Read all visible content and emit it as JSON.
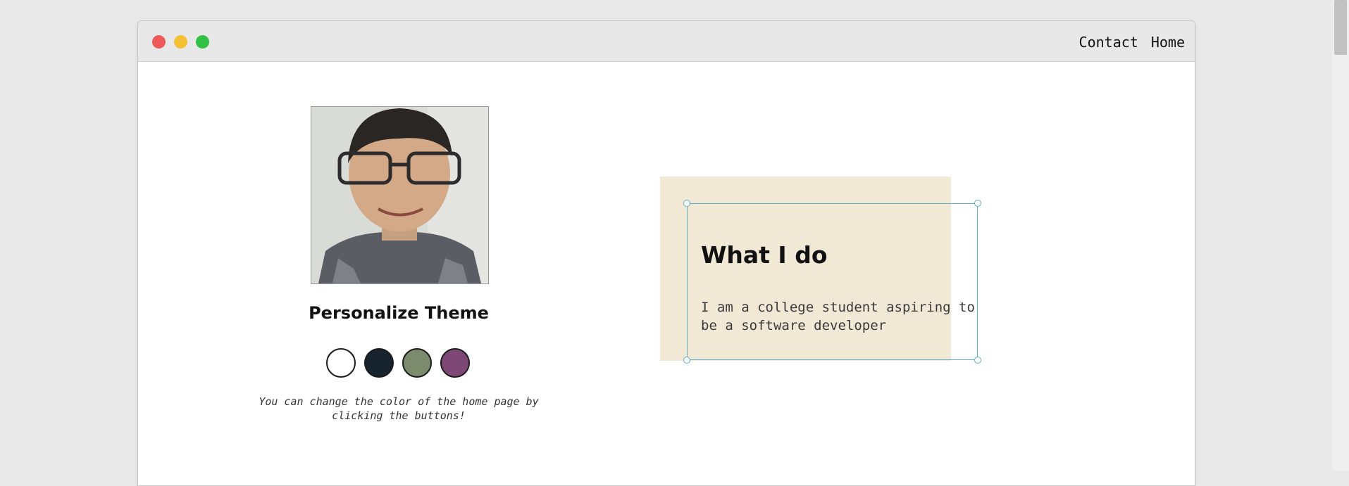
{
  "nav": {
    "contact_label": "Contact",
    "home_label": "Home"
  },
  "profile": {
    "theme_heading": "Personalize Theme",
    "swatches": [
      {
        "name": "white",
        "color": "#ffffff"
      },
      {
        "name": "navy",
        "color": "#17242f"
      },
      {
        "name": "sage",
        "color": "#7b8b6b"
      },
      {
        "name": "plum",
        "color": "#7d4876"
      }
    ],
    "hint": "You can change the color of the home page by clicking the buttons!"
  },
  "card": {
    "title": "What I do",
    "text": "I am a college student aspiring to be a software developer"
  },
  "colors": {
    "card_background": "#f1e9d6",
    "selection_outline": "#5eaec7"
  }
}
